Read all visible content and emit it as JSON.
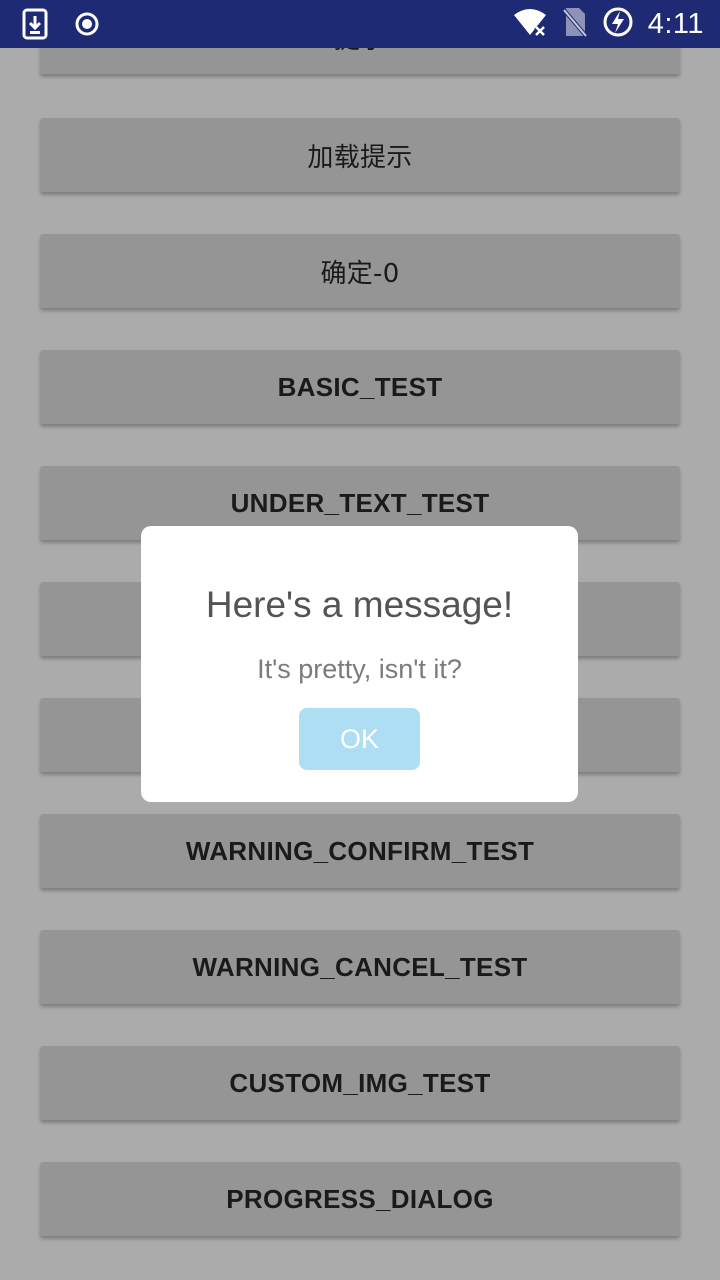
{
  "status_bar": {
    "time": "4:11",
    "icons": [
      "download-icon",
      "record-icon",
      "wifi-off-icon",
      "no-sim-icon",
      "battery-charging-icon"
    ]
  },
  "buttons": [
    {
      "label": "提示"
    },
    {
      "label": "加载提示"
    },
    {
      "label": "确定-0"
    },
    {
      "label": "BASIC_TEST"
    },
    {
      "label": "UNDER_TEXT_TEST"
    },
    {
      "label": ""
    },
    {
      "label": ""
    },
    {
      "label": "WARNING_CONFIRM_TEST"
    },
    {
      "label": "WARNING_CANCEL_TEST"
    },
    {
      "label": "CUSTOM_IMG_TEST"
    },
    {
      "label": "PROGRESS_DIALOG"
    }
  ],
  "dialog": {
    "title": "Here's a message!",
    "message": "It's pretty, isn't it?",
    "ok_label": "OK"
  },
  "colors": {
    "status_bar": "#1f2a74",
    "background": "#ababab",
    "button": "#959595",
    "ok_button": "#aedef4"
  }
}
